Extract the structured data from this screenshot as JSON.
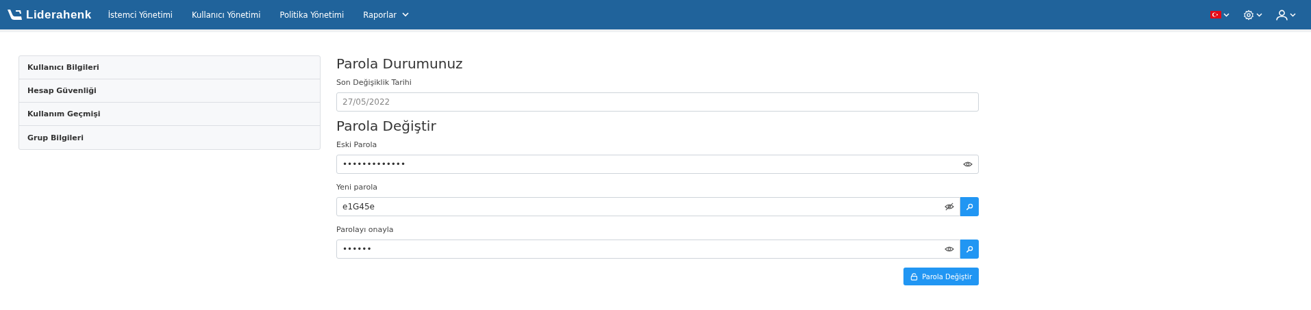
{
  "navbar": {
    "logo": "Liderahenk",
    "menu": [
      {
        "label": "İstemci Yönetimi",
        "dropdown": false
      },
      {
        "label": "Kullanıcı Yönetimi",
        "dropdown": false
      },
      {
        "label": "Politika Yönetimi",
        "dropdown": false
      },
      {
        "label": "Raporlar",
        "dropdown": true
      }
    ]
  },
  "sidebar": {
    "items": [
      {
        "label": "Kullanıcı Bilgileri",
        "selected": false
      },
      {
        "label": "Hesap Güvenliği",
        "selected": false
      },
      {
        "label": "Kullanım Geçmişi",
        "selected": false
      },
      {
        "label": "Grup Bilgileri",
        "selected": false
      }
    ]
  },
  "status_section": {
    "title": "Parola Durumunuz",
    "label": "Son Değişiklik Tarihi",
    "value": "27/05/2022"
  },
  "change_section": {
    "title": "Parola Değiştir",
    "fields": [
      {
        "label": "Eski Parola",
        "value": "•••••••••••••",
        "revealed": false,
        "generate_button": false
      },
      {
        "label": "Yeni parola",
        "value": "e1G45e",
        "revealed": true,
        "generate_button": true
      },
      {
        "label": "Parolayı onayla",
        "value": "••••••",
        "revealed": false,
        "generate_button": true
      }
    ],
    "submit": "Parola Değiştir"
  }
}
